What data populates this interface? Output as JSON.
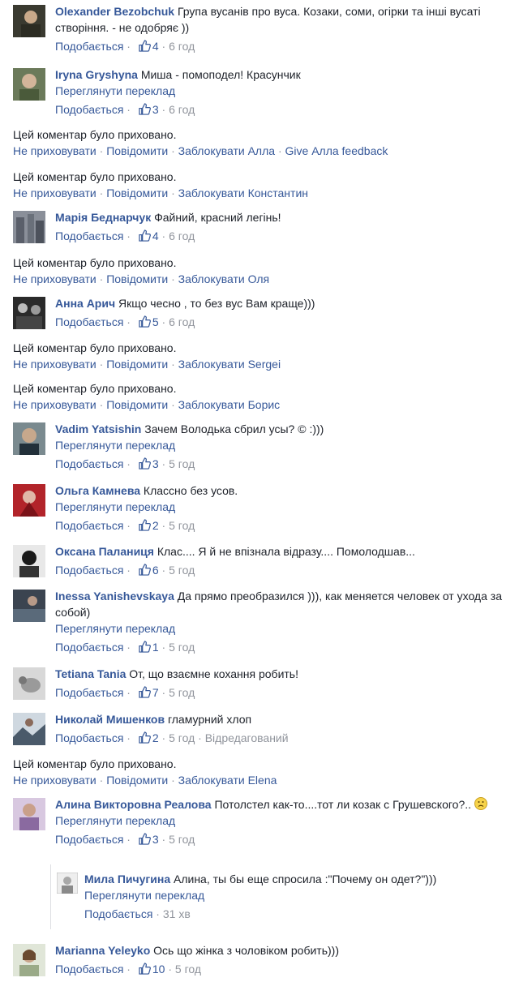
{
  "common": {
    "like": "Подобається",
    "translate": "Переглянути переклад",
    "sep": " · ",
    "hidden_text": "Цей коментар було приховано.",
    "unhide": "Не приховувати",
    "report": "Повідомити",
    "block_prefix": "Заблокувати "
  },
  "comments": [
    {
      "author": "Olexander Bezobchuk",
      "text": "Група вусанів про вуса. Козаки, соми, огірки та інші вусаті створіння. - не одобряє ))",
      "likes": "4",
      "time": "6 год"
    },
    {
      "author": "Iryna Gryshyna",
      "text": "Миша - помоподел! Красунчик",
      "likes": "3",
      "time": "6 год"
    },
    {
      "author": "Марія Беднарчук",
      "text": "Файний, красний легінь!",
      "likes": "4",
      "time": "6 год"
    },
    {
      "author": "Анна Арич",
      "text": "Якщо чесно , то без вус Вам краще)))",
      "likes": "5",
      "time": "6 год"
    },
    {
      "author": "Vadim Yatsishin",
      "text": "Зачем Володька сбрил усы? © :)))",
      "likes": "3",
      "time": "5 год"
    },
    {
      "author": "Ольга Камнева",
      "text": "Классно без усов.",
      "likes": "2",
      "time": "5 год"
    },
    {
      "author": "Оксана Паланиця",
      "text": "Клас.... Я й не впізнала відразу.... Помолодшав...",
      "likes": "6",
      "time": "5 год"
    },
    {
      "author": "Inessa Yanishevskaya",
      "text": "Да прямо преобразился ))), как меняется человек от ухода за собой)",
      "likes": "1",
      "time": "5 год"
    },
    {
      "author": "Tetiana Tania",
      "text": "От, що взаємне кохання робить!",
      "likes": "7",
      "time": "5 год"
    },
    {
      "author": "Николай Мишенков",
      "text": "гламурний хлоп",
      "likes": "2",
      "time": "5 год",
      "edited": "Відредагований"
    },
    {
      "author": "Алина Викторовна Реалова",
      "text": "Потолстел как-то....тот ли козак с Грушевского?..",
      "likes": "3",
      "time": "5 год"
    },
    {
      "author": "Мила Пичугина",
      "text": "Алина, ты бы еще спросила :\"Почему он одет?\")))",
      "time": "31 хв"
    },
    {
      "author": "Marianna Yeleyko",
      "text": "Ось що жінка з чоловіком робить)))",
      "likes": "10",
      "time": "5 год"
    }
  ],
  "hidden": [
    {
      "block_name": "Алла",
      "extra": "Give Алла feedback"
    },
    {
      "block_name": "Константин"
    },
    {
      "block_name": "Оля"
    },
    {
      "block_name": "Sergei"
    },
    {
      "block_name": "Борис"
    },
    {
      "block_name": "Elena"
    }
  ],
  "colors": {
    "link": "#365899",
    "meta": "#90949c",
    "text": "#1d2129"
  }
}
